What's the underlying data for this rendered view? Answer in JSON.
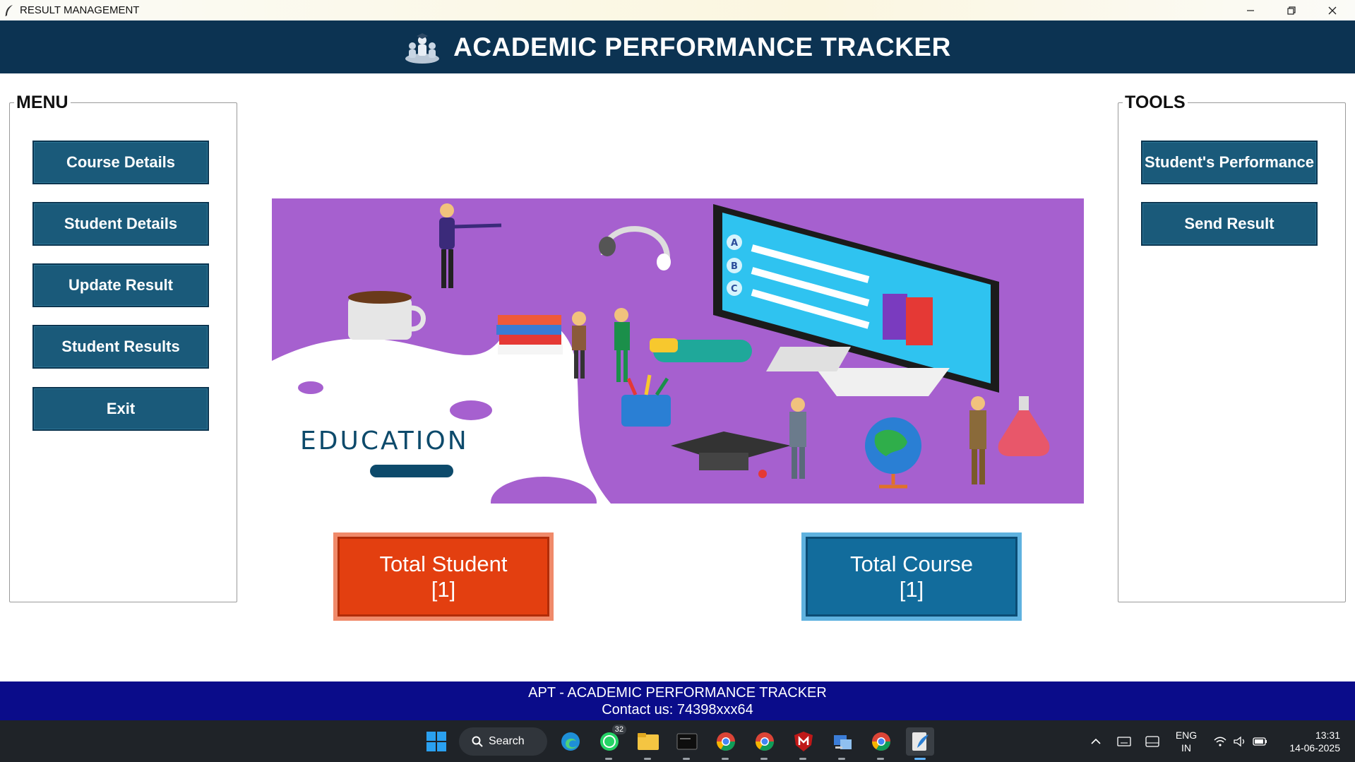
{
  "window": {
    "title": "RESULT MANAGEMENT",
    "controls": [
      "minimize",
      "restore",
      "close"
    ]
  },
  "header": {
    "title": "ACADEMIC PERFORMANCE TRACKER"
  },
  "menu": {
    "label": "MENU",
    "buttons": [
      {
        "label": "Course Details"
      },
      {
        "label": "Student Details"
      },
      {
        "label": "Update Result"
      },
      {
        "label": "Student Results"
      },
      {
        "label": "Exit"
      }
    ]
  },
  "tools": {
    "label": "TOOLS",
    "buttons": [
      {
        "label": "Student's Performance"
      },
      {
        "label": "Send Result"
      }
    ]
  },
  "banner": {
    "text": "EDUCATION",
    "quiz_options": [
      "A",
      "B",
      "C"
    ]
  },
  "stats": {
    "student": {
      "title": "Total Student",
      "value": "[1]"
    },
    "course": {
      "title": "Total Course",
      "value": "[1]"
    }
  },
  "footer": {
    "line1": "APT - ACADEMIC PERFORMANCE TRACKER",
    "line2": "Contact us: 74398xxx64"
  },
  "taskbar": {
    "search_label": "Search",
    "whatsapp_badge": "32",
    "language": "ENG",
    "region": "IN",
    "time": "13:31",
    "date": "14-06-2025"
  },
  "colors": {
    "header_bg": "#0c3352",
    "button_bg": "#1a5a7a",
    "student_card": "#e33f10",
    "course_card": "#126c9c",
    "footer_bg": "#0a0c8a",
    "banner_bg": "#a660cf"
  }
}
